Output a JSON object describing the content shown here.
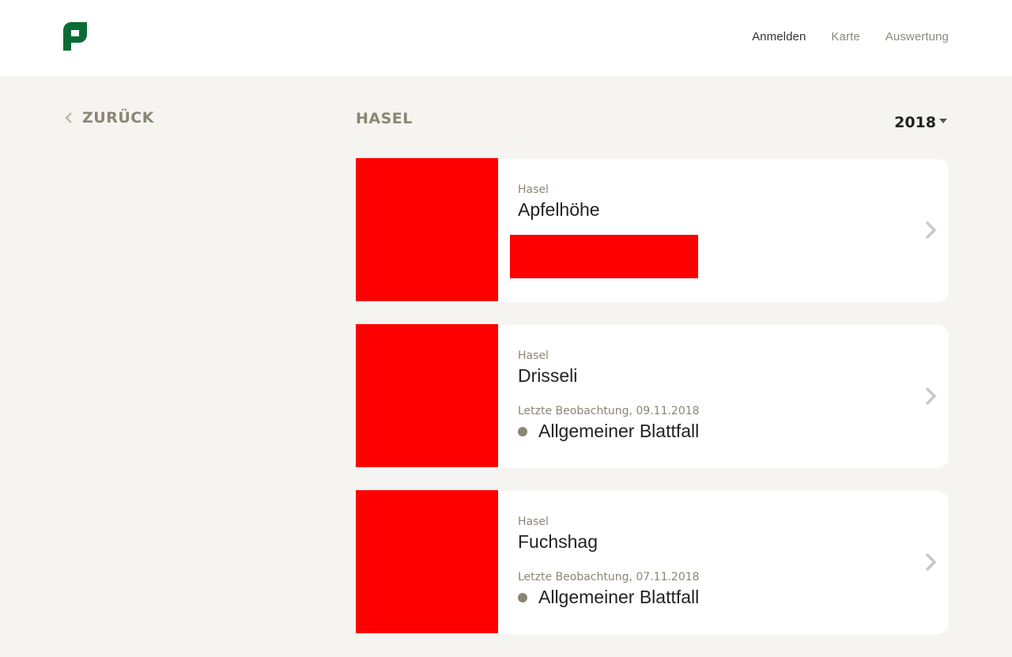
{
  "header": {
    "nav": [
      {
        "label": "Anmelden",
        "active": true
      },
      {
        "label": "Karte",
        "active": false
      },
      {
        "label": "Auswertung",
        "active": false
      }
    ],
    "logo_color": "#0a6b35"
  },
  "back": {
    "label": "ZURÜCK",
    "icon": "chevron-left-icon"
  },
  "section": {
    "title": "HASEL"
  },
  "year_select": {
    "value": "2018"
  },
  "cards": [
    {
      "species": "Hasel",
      "station": "Apfelhöhe",
      "has_observation": false,
      "observation_label": "",
      "observation_phase": ""
    },
    {
      "species": "Hasel",
      "station": "Drisseli",
      "has_observation": true,
      "observation_label": "Letzte Beobachtung, 09.11.2018",
      "observation_phase": "Allgemeiner Blattfall"
    },
    {
      "species": "Hasel",
      "station": "Fuchshag",
      "has_observation": true,
      "observation_label": "Letzte Beobachtung, 07.11.2018",
      "observation_phase": "Allgemeiner Blattfall"
    }
  ],
  "colors": {
    "accent_muted": "#8b8574",
    "placeholder": "#ff0000",
    "background": "#f5f4f0"
  }
}
